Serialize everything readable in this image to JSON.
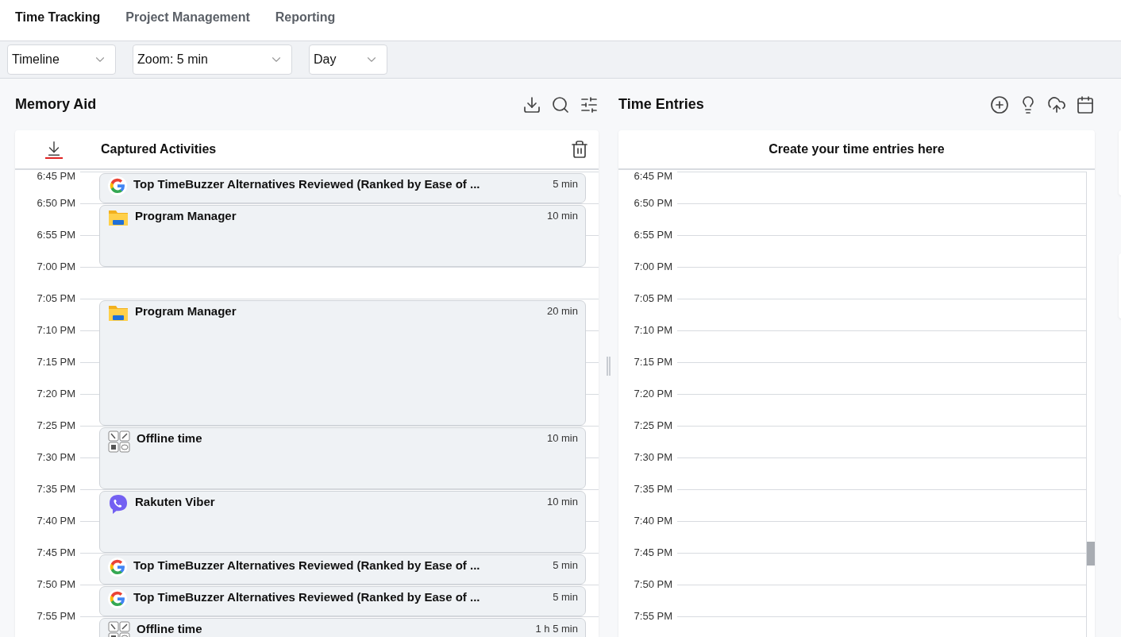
{
  "nav": {
    "tabs": [
      {
        "label": "Time Tracking",
        "selected": true
      },
      {
        "label": "Project Management",
        "selected": false
      },
      {
        "label": "Reporting",
        "selected": false
      }
    ]
  },
  "toolbar": {
    "dropdowns": [
      {
        "value": "Timeline"
      },
      {
        "value": "Zoom: 5 min"
      },
      {
        "value": "Day"
      }
    ]
  },
  "memory_aid": {
    "title": "Memory Aid",
    "card_title": "Captured Activities",
    "times": [
      "6:45 PM",
      "6:50 PM",
      "6:55 PM",
      "7:00 PM",
      "7:05 PM",
      "7:10 PM",
      "7:15 PM",
      "7:20 PM",
      "7:25 PM",
      "7:30 PM",
      "7:35 PM",
      "7:40 PM",
      "7:45 PM",
      "7:50 PM",
      "7:55 PM"
    ],
    "activities": [
      {
        "kind": "google",
        "title": "Top TimeBuzzer Alternatives Reviewed (Ranked by Ease of ...",
        "duration": "5 min"
      },
      {
        "kind": "folder",
        "title": "Program Manager",
        "duration": "10 min"
      },
      {
        "kind": "gap"
      },
      {
        "kind": "folder",
        "title": "Program Manager",
        "duration": "20 min"
      },
      {
        "kind": "offline",
        "title": "Offline time",
        "duration": "10 min"
      },
      {
        "kind": "viber",
        "title": "Rakuten Viber",
        "duration": "10 min"
      },
      {
        "kind": "google",
        "title": "Top TimeBuzzer Alternatives Reviewed (Ranked by Ease of ...",
        "duration": "5 min"
      },
      {
        "kind": "google",
        "title": "Top TimeBuzzer Alternatives Reviewed (Ranked by Ease of ...",
        "duration": "5 min"
      },
      {
        "kind": "offline",
        "title": "Offline time",
        "duration": "1 h 5 min"
      }
    ]
  },
  "time_entries": {
    "title": "Time Entries",
    "card_title": "Create your time entries here",
    "times": [
      "6:45 PM",
      "6:50 PM",
      "6:55 PM",
      "7:00 PM",
      "7:05 PM",
      "7:10 PM",
      "7:15 PM",
      "7:20 PM",
      "7:25 PM",
      "7:30 PM",
      "7:35 PM",
      "7:40 PM",
      "7:45 PM",
      "7:50 PM",
      "7:55 PM"
    ]
  }
}
